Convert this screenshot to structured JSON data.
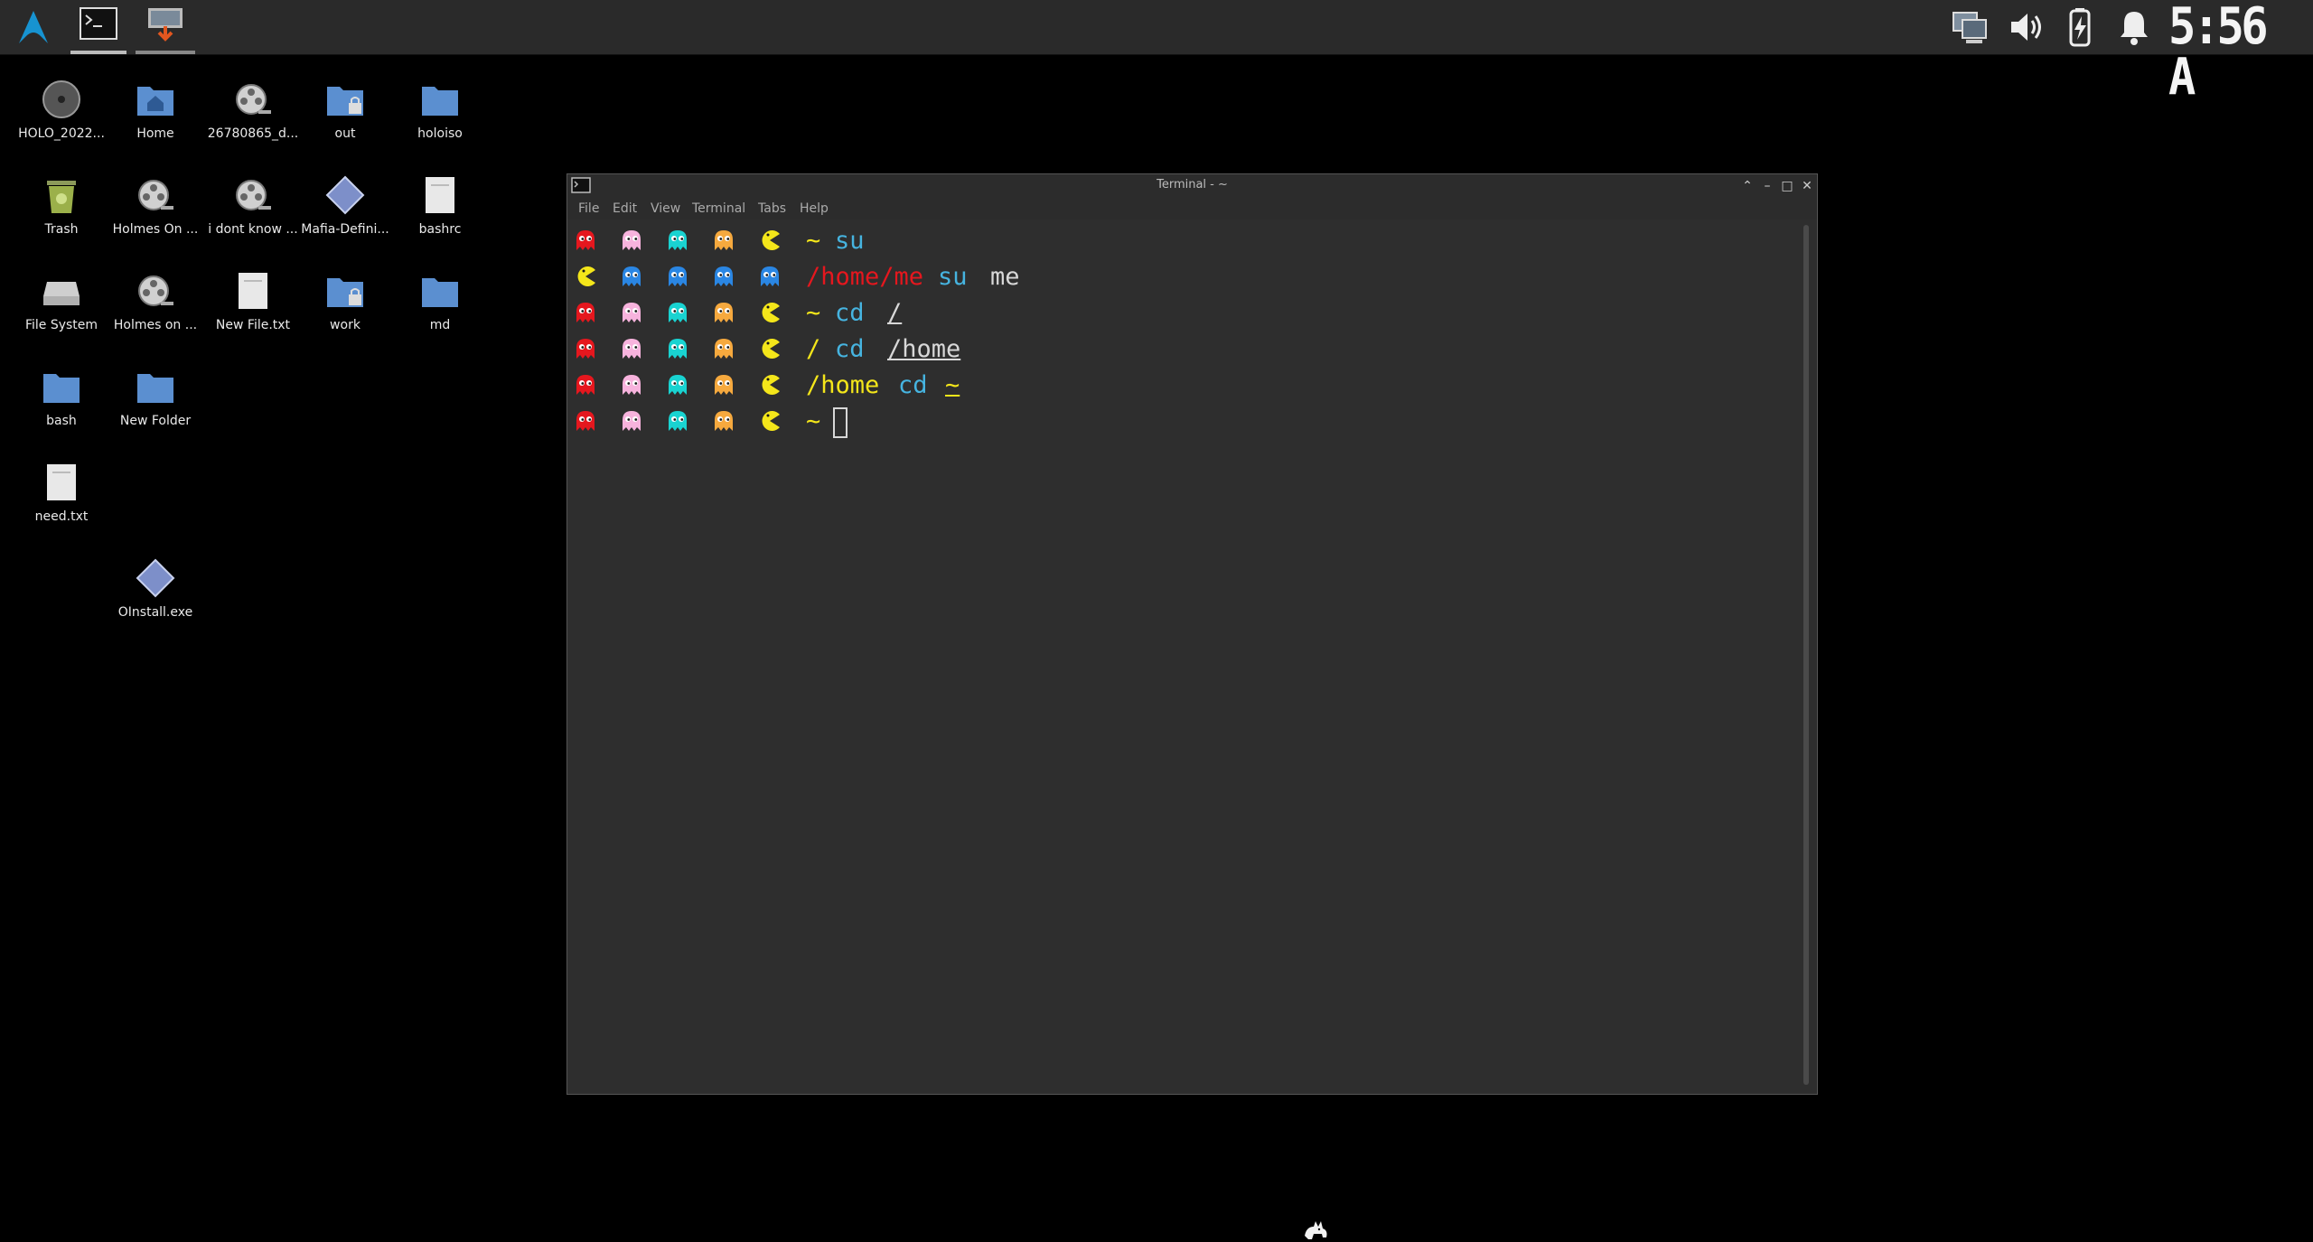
{
  "panel": {
    "clock": "5:56 A",
    "launcher_icon": "arch-linux-logo-icon",
    "task_terminal_icon": "terminal-icon",
    "task_other_icon": "image-viewer-icon",
    "tray_icons": [
      "network-icon",
      "volume-icon",
      "battery-icon",
      "notification-bell-icon"
    ]
  },
  "desktop": {
    "icons": [
      {
        "label": "HOLO_2022...",
        "icon": "disc-icon"
      },
      {
        "label": "Home",
        "icon": "home-folder-icon"
      },
      {
        "label": "26780865_d...",
        "icon": "video-reel-icon"
      },
      {
        "label": "out",
        "icon": "locked-folder-icon"
      },
      {
        "label": "holoiso",
        "icon": "folder-icon"
      },
      {
        "label": "Trash",
        "icon": "trash-icon"
      },
      {
        "label": "Holmes On ...",
        "icon": "video-reel-icon"
      },
      {
        "label": "i dont know ...",
        "icon": "video-reel-icon"
      },
      {
        "label": "Mafia-Defini...",
        "icon": "executable-icon"
      },
      {
        "label": "bashrc",
        "icon": "text-file-icon"
      },
      {
        "label": "File System",
        "icon": "drive-icon"
      },
      {
        "label": "Holmes on ...",
        "icon": "video-reel-icon"
      },
      {
        "label": "New File.txt",
        "icon": "text-file-icon"
      },
      {
        "label": "work",
        "icon": "locked-folder-icon"
      },
      {
        "label": "md",
        "icon": "folder-icon"
      },
      {
        "label": "bash",
        "icon": "folder-icon"
      },
      {
        "label": "New Folder",
        "icon": "folder-icon"
      },
      {
        "label": "need.txt",
        "icon": "text-file-icon"
      },
      {
        "label": "OInstall.exe",
        "icon": "executable-icon"
      }
    ]
  },
  "terminal": {
    "title": "Terminal - ~",
    "menu": [
      "File",
      "Edit",
      "View",
      "Terminal",
      "Tabs",
      "Help"
    ],
    "lines": [
      {
        "segments": [
          "~",
          "su"
        ]
      },
      {
        "segments": [
          "/home/me",
          "su",
          "me"
        ]
      },
      {
        "segments": [
          "~",
          "cd",
          "/"
        ]
      },
      {
        "segments": [
          "/",
          "cd",
          "/home"
        ]
      },
      {
        "segments": [
          "/home",
          "cd",
          "~"
        ]
      },
      {
        "segments": [
          "~"
        ]
      }
    ],
    "colors": {
      "red": "#e5171e",
      "pink": "#f7b3dd",
      "cyan": "#19d3d1",
      "orange": "#f6a93e",
      "yellow": "#f4e61a",
      "blue": "#2a86e3"
    }
  }
}
